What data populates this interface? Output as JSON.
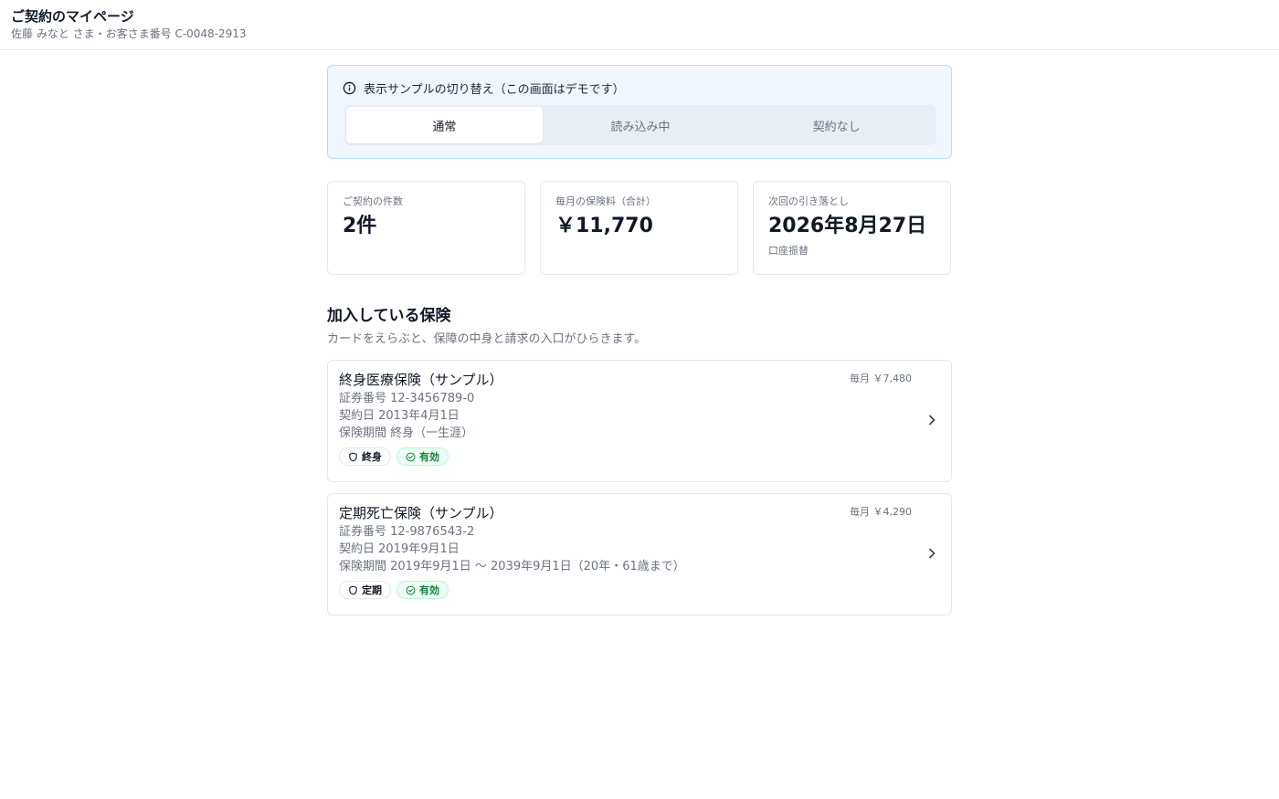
{
  "header": {
    "title": "ご契約のマイページ",
    "subtitle": "佐藤 みなと さま・お客さま番号 C-0048-2913"
  },
  "demo": {
    "heading": "表示サンプルの切り替え（この画面はデモです）",
    "tabs": [
      {
        "label": "通常",
        "active": true
      },
      {
        "label": "読み込み中",
        "active": false
      },
      {
        "label": "契約なし",
        "active": false
      }
    ]
  },
  "stats": [
    {
      "label": "ご契約の件数",
      "value": "2件",
      "note": ""
    },
    {
      "label": "毎月の保険料（合計）",
      "value": "￥11,770",
      "note": ""
    },
    {
      "label": "次回の引き落とし",
      "value": "2026年8月27日",
      "note": "口座振替"
    }
  ],
  "section": {
    "title": "加入している保険",
    "subtitle": "カードをえらぶと、保障の中身と請求の入口がひらきます。"
  },
  "policies": [
    {
      "name": "終身医療保険（サンプル）",
      "premium": "毎月 ￥7,480",
      "number": "証券番号 12-3456789-0",
      "date": "契約日 2013年4月1日",
      "period": "保険期間 終身（一生涯）",
      "type_badge": "終身",
      "status_badge": "有効"
    },
    {
      "name": "定期死亡保険（サンプル）",
      "premium": "毎月 ￥4,290",
      "number": "証券番号 12-9876543-2",
      "date": "契約日 2019年9月1日",
      "period": "保険期間 2019年9月1日 〜 2039年9月1日（20年・61歳まで）",
      "type_badge": "定期",
      "status_badge": "有効"
    }
  ],
  "icons": {
    "info": "info-icon",
    "chevron": "chevron-right-icon",
    "shield": "shield-icon",
    "check": "check-circle-icon"
  },
  "colors": {
    "accent_bg": "#eff6ff",
    "accent_border": "#bfdbfe",
    "status_green": "#15803d"
  }
}
